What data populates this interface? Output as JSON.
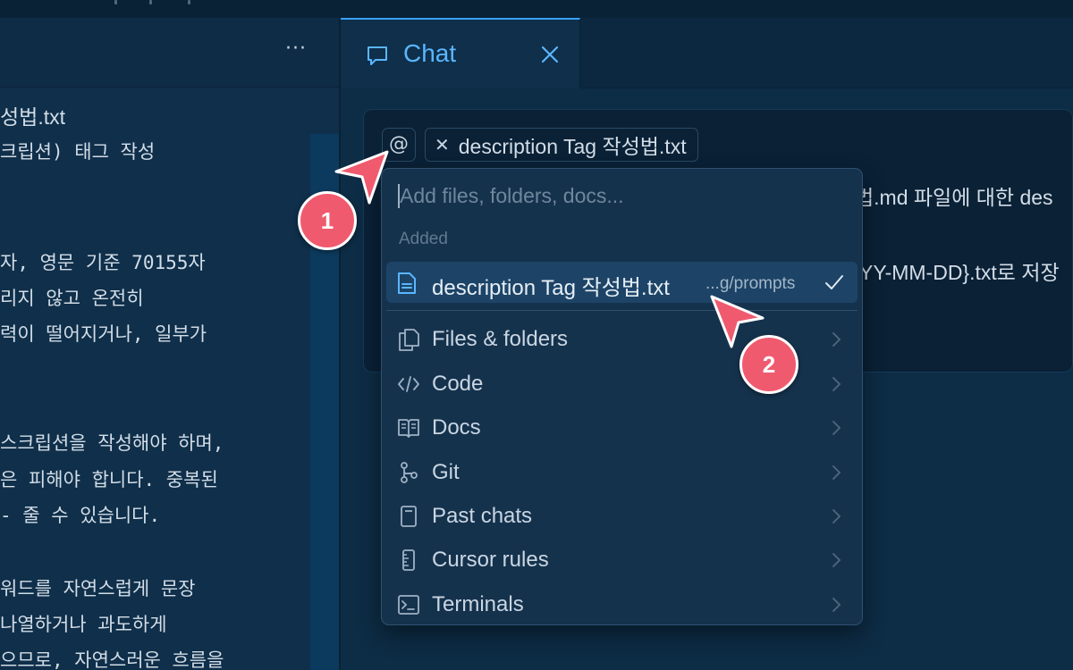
{
  "left_pane": {
    "more_label": "···",
    "lines": [
      "성법.txt",
      "크립션) 태그 작성",
      "자, 영문 기준 70155자",
      "리지 않고 온전히",
      "력이 떨어지거나, 일부가",
      "스크립션을 작성해야 하며,",
      "은 피해야 합니다. 중복된",
      "- 줄 수 있습니다.",
      "워드를 자연스럽게 문장",
      "나열하거나 과도하게",
      "으므로, 자연스러운 흐름을"
    ]
  },
  "chat_tab": {
    "label": "Chat",
    "icon": "chat-bubble-icon",
    "close_icon": "close-icon"
  },
  "composer": {
    "at_label": "@",
    "chip_remove": "✕",
    "chip_label": "description Tag 작성법.txt",
    "text_line1": "법.md 파일에 대한 des",
    "text_line2": "YY-MM-DD}.txt로 저장"
  },
  "dropdown": {
    "search_placeholder": "Add files, folders, docs...",
    "section_label": "Added",
    "added_item": {
      "name": "description Tag 작성법.txt",
      "path": "...g/prompts",
      "icon": "file-icon",
      "status_icon": "check-icon"
    },
    "items": [
      {
        "label": "Files & folders",
        "icon": "files-icon"
      },
      {
        "label": "Code",
        "icon": "code-icon"
      },
      {
        "label": "Docs",
        "icon": "book-icon"
      },
      {
        "label": "Git",
        "icon": "git-branch-icon"
      },
      {
        "label": "Past chats",
        "icon": "notebook-icon"
      },
      {
        "label": "Cursor rules",
        "icon": "ruler-icon"
      },
      {
        "label": "Terminals",
        "icon": "terminal-icon"
      }
    ]
  },
  "annotations": [
    {
      "label": "1"
    },
    {
      "label": "2"
    }
  ],
  "colors": {
    "accent": "#3aa0ff",
    "badge": "#f05a6f",
    "background": "#0d2c45",
    "dropdown": "#15324d",
    "selected": "#1d4467"
  }
}
